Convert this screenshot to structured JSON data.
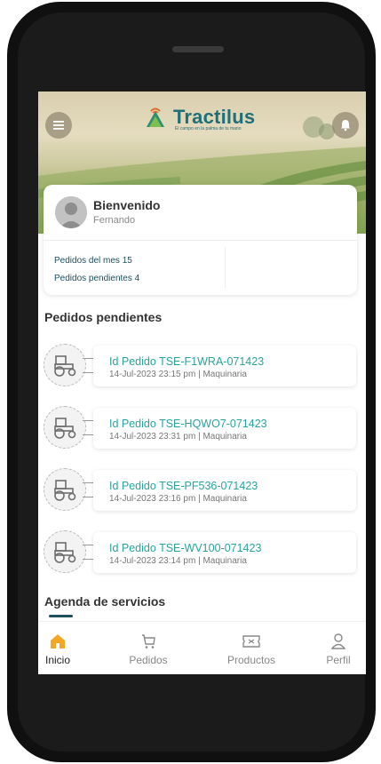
{
  "app": {
    "brand": "Tractilus",
    "tagline": "El campo en la palma de tu mano"
  },
  "welcome": {
    "title": "Bienvenido",
    "user_name": "Fernando"
  },
  "stats": {
    "month_label": "Pedidos del mes",
    "month_value": "15",
    "pending_label": "Pedidos pendientes",
    "pending_value": "4"
  },
  "pending_section": {
    "title": "Pedidos pendientes",
    "orders": [
      {
        "id": "Id Pedido TSE-F1WRA-071423",
        "meta": "14-Jul-2023 23:15 pm | Maquinaria"
      },
      {
        "id": "Id Pedido TSE-HQWO7-071423",
        "meta": "14-Jul-2023 23:31 pm | Maquinaria"
      },
      {
        "id": "Id Pedido TSE-PF536-071423",
        "meta": "14-Jul-2023 23:16 pm | Maquinaria"
      },
      {
        "id": "Id Pedido TSE-WV100-071423",
        "meta": "14-Jul-2023 23:14 pm | Maquinaria"
      }
    ]
  },
  "agenda_section": {
    "title": "Agenda de servicios"
  },
  "nav": {
    "items": [
      {
        "label": "Inicio",
        "icon": "home-icon",
        "active": true
      },
      {
        "label": "Pedidos",
        "icon": "cart-icon",
        "active": false
      },
      {
        "label": "Productos",
        "icon": "ticket-icon",
        "active": false
      },
      {
        "label": "Perfil",
        "icon": "user-icon",
        "active": false
      }
    ]
  },
  "colors": {
    "brand": "#1f6f77",
    "accent": "#2aa39d",
    "active_tab": "#f5a623",
    "dark_teal": "#1d4f5e"
  }
}
